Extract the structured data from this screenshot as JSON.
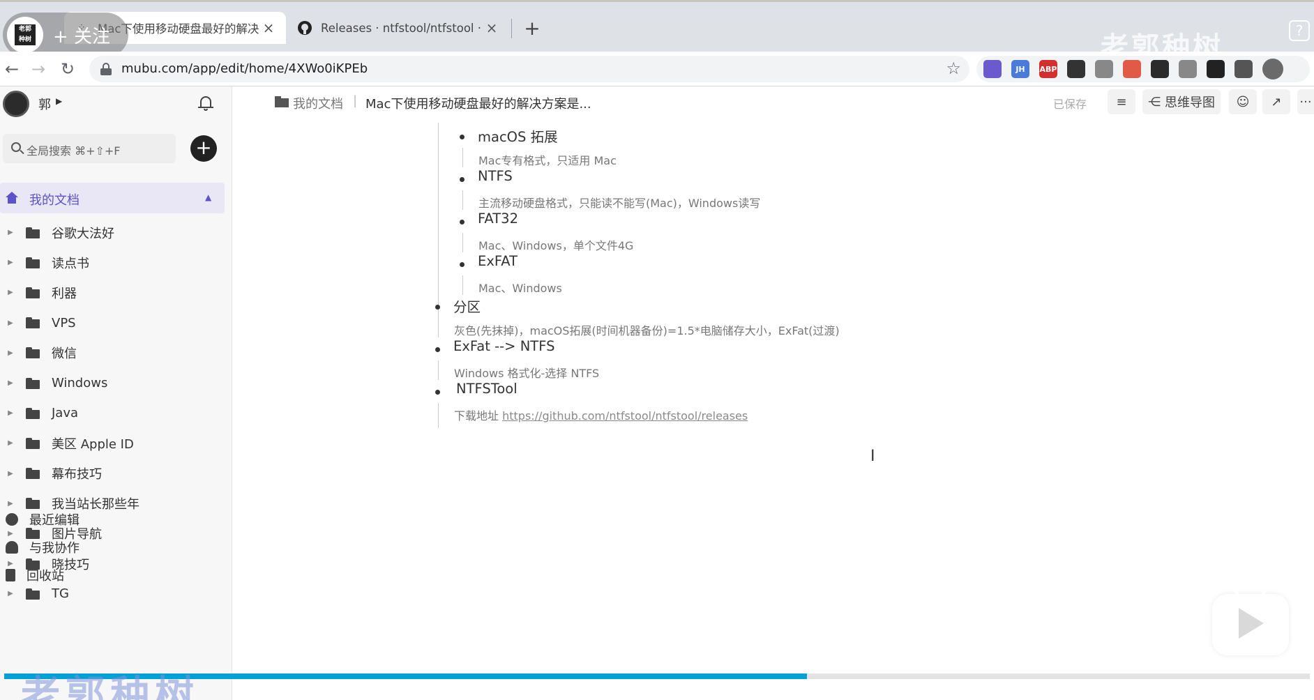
{
  "browser": {
    "tabs": [
      {
        "title": "Mac下使用移动硬盘最好的解决",
        "active": true
      },
      {
        "title": "Releases · ntfstool/ntfstool · Gi",
        "active": false
      }
    ],
    "new_tab_glyph": "+",
    "close_glyph": "×",
    "url": "mubu.com/app/edit/home/4XWo0iKPEb",
    "extensions": [
      {
        "name": "colorzilla-icon",
        "label": "",
        "color": "#6a5acd"
      },
      {
        "name": "jh-icon",
        "label": "JH",
        "color": "#4a7bd8"
      },
      {
        "name": "adblock-icon",
        "label": "ABP",
        "color": "#d32f2f"
      },
      {
        "name": "bookmark-ext-icon",
        "label": "",
        "color": "#333333"
      },
      {
        "name": "tag-ext-icon",
        "label": "",
        "color": "#888888"
      },
      {
        "name": "network-ext-icon",
        "label": "",
        "color": "#e05a47"
      },
      {
        "name": "evernote-icon",
        "label": "",
        "color": "#2b2b2b"
      },
      {
        "name": "cloud-ext-icon",
        "label": "",
        "color": "#888888"
      },
      {
        "name": "incognito-ext-icon",
        "label": "",
        "color": "#222222"
      },
      {
        "name": "puzzle-icon",
        "label": "",
        "color": "#555555"
      }
    ]
  },
  "overlay": {
    "follow_label": "+ 关注",
    "avatar_text": "老郭 种树",
    "watermark_top": "老郭种树",
    "help_glyph": "?",
    "watermark_bottom": "老郭种树",
    "progress": 0.615
  },
  "sidebar": {
    "user_name": "郭",
    "search_placeholder": "全局搜索 ⌘+⇧+F",
    "add_glyph": "+",
    "my_docs_label": "我的文档",
    "folders": [
      "谷歌大法好",
      "读点书",
      "利器",
      "VPS",
      "微信",
      "Windows",
      "Java",
      "美区 Apple ID",
      "幕布技巧",
      "我当站长那些年",
      "图片导航",
      "晓技巧",
      "TG"
    ],
    "recent_label": "最近编辑",
    "shared_label": "与我协作",
    "trash_label": "回收站"
  },
  "header": {
    "breadcrumb_root": "我的文档",
    "breadcrumb_sep": "|",
    "doc_title": "Mac下使用移动硬盘最好的解决方案是...",
    "saved_status": "已保存",
    "mindmap_label": "思维导图",
    "more_glyph": "···"
  },
  "outline": {
    "formats": [
      {
        "title": "macOS 拓展",
        "note": "Mac专有格式，只适用 Mac"
      },
      {
        "title": "NTFS",
        "note": "主流移动硬盘格式，只能读不能写(Mac)，Windows读写"
      },
      {
        "title": "FAT32",
        "note": "Mac、Windows，单个文件4G"
      },
      {
        "title": "ExFAT",
        "note": "Mac、Windows"
      }
    ],
    "partition": {
      "title": "分区",
      "note": "灰色(先抹掉)，macOS拓展(时间机器备份)=1.5*电脑储存大小，ExFat(过渡)"
    },
    "convert": {
      "title": "ExFat --> NTFS",
      "note": "Windows 格式化-选择 NTFS"
    },
    "tool": {
      "title": "NTFSTool",
      "note_prefix": "下载地址 ",
      "link": "https://github.com/ntfstool/ntfstool/releases"
    }
  }
}
